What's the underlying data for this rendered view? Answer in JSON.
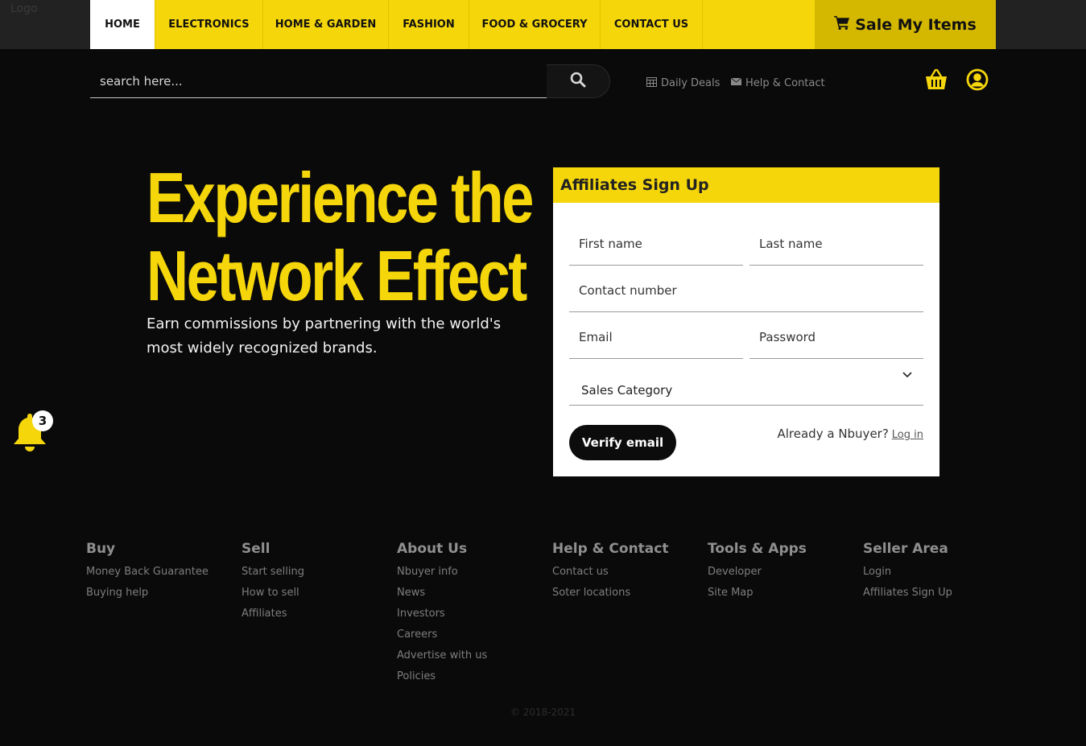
{
  "logo": "Logo",
  "nav": {
    "items": [
      "HOME",
      "ELECTRONICS",
      "HOME & GARDEN",
      "FASHION",
      "FOOD & GROCERY",
      "CONTACT US"
    ],
    "sale_button": "Sale My Items"
  },
  "search": {
    "placeholder": "search here..."
  },
  "util": {
    "daily_deals": "Daily Deals",
    "help_contact": "Help & Contact"
  },
  "hero": {
    "title_line1": "Experience the",
    "title_line2": "Network Effect",
    "subtitle": "Earn commissions by partnering with the world's most widely recognized brands."
  },
  "form": {
    "heading": "Affiliates Sign Up",
    "first_name": "First name",
    "last_name": "Last name",
    "contact_number": "Contact number",
    "email": "Email",
    "password": "Password",
    "sales_category": "Sales Category",
    "verify_button": "Verify email",
    "already_text": "Already a Nbuyer?",
    "login_link": "Log in"
  },
  "notifications": {
    "count": "3"
  },
  "footer": {
    "columns": [
      {
        "title": "Buy",
        "links": [
          "Money Back Guarantee",
          "Buying help"
        ]
      },
      {
        "title": "Sell",
        "links": [
          "Start selling",
          "How to sell",
          "Affiliates"
        ]
      },
      {
        "title": "About Us",
        "links": [
          "Nbuyer info",
          "News",
          "Investors",
          "Careers",
          "Advertise with us",
          "Policies"
        ]
      },
      {
        "title": "Help & Contact",
        "links": [
          "Contact us",
          "Soter locations"
        ]
      },
      {
        "title": "Tools & Apps",
        "links": [
          "Developer",
          "Site Map"
        ]
      },
      {
        "title": "Seller Area",
        "links": [
          "Login",
          "Affiliates Sign Up"
        ]
      }
    ],
    "copyright": "© 2018-2021"
  },
  "colors": {
    "accent": "#f5d60a",
    "accent_dark": "#d4b800",
    "background": "#0a0a0b"
  }
}
